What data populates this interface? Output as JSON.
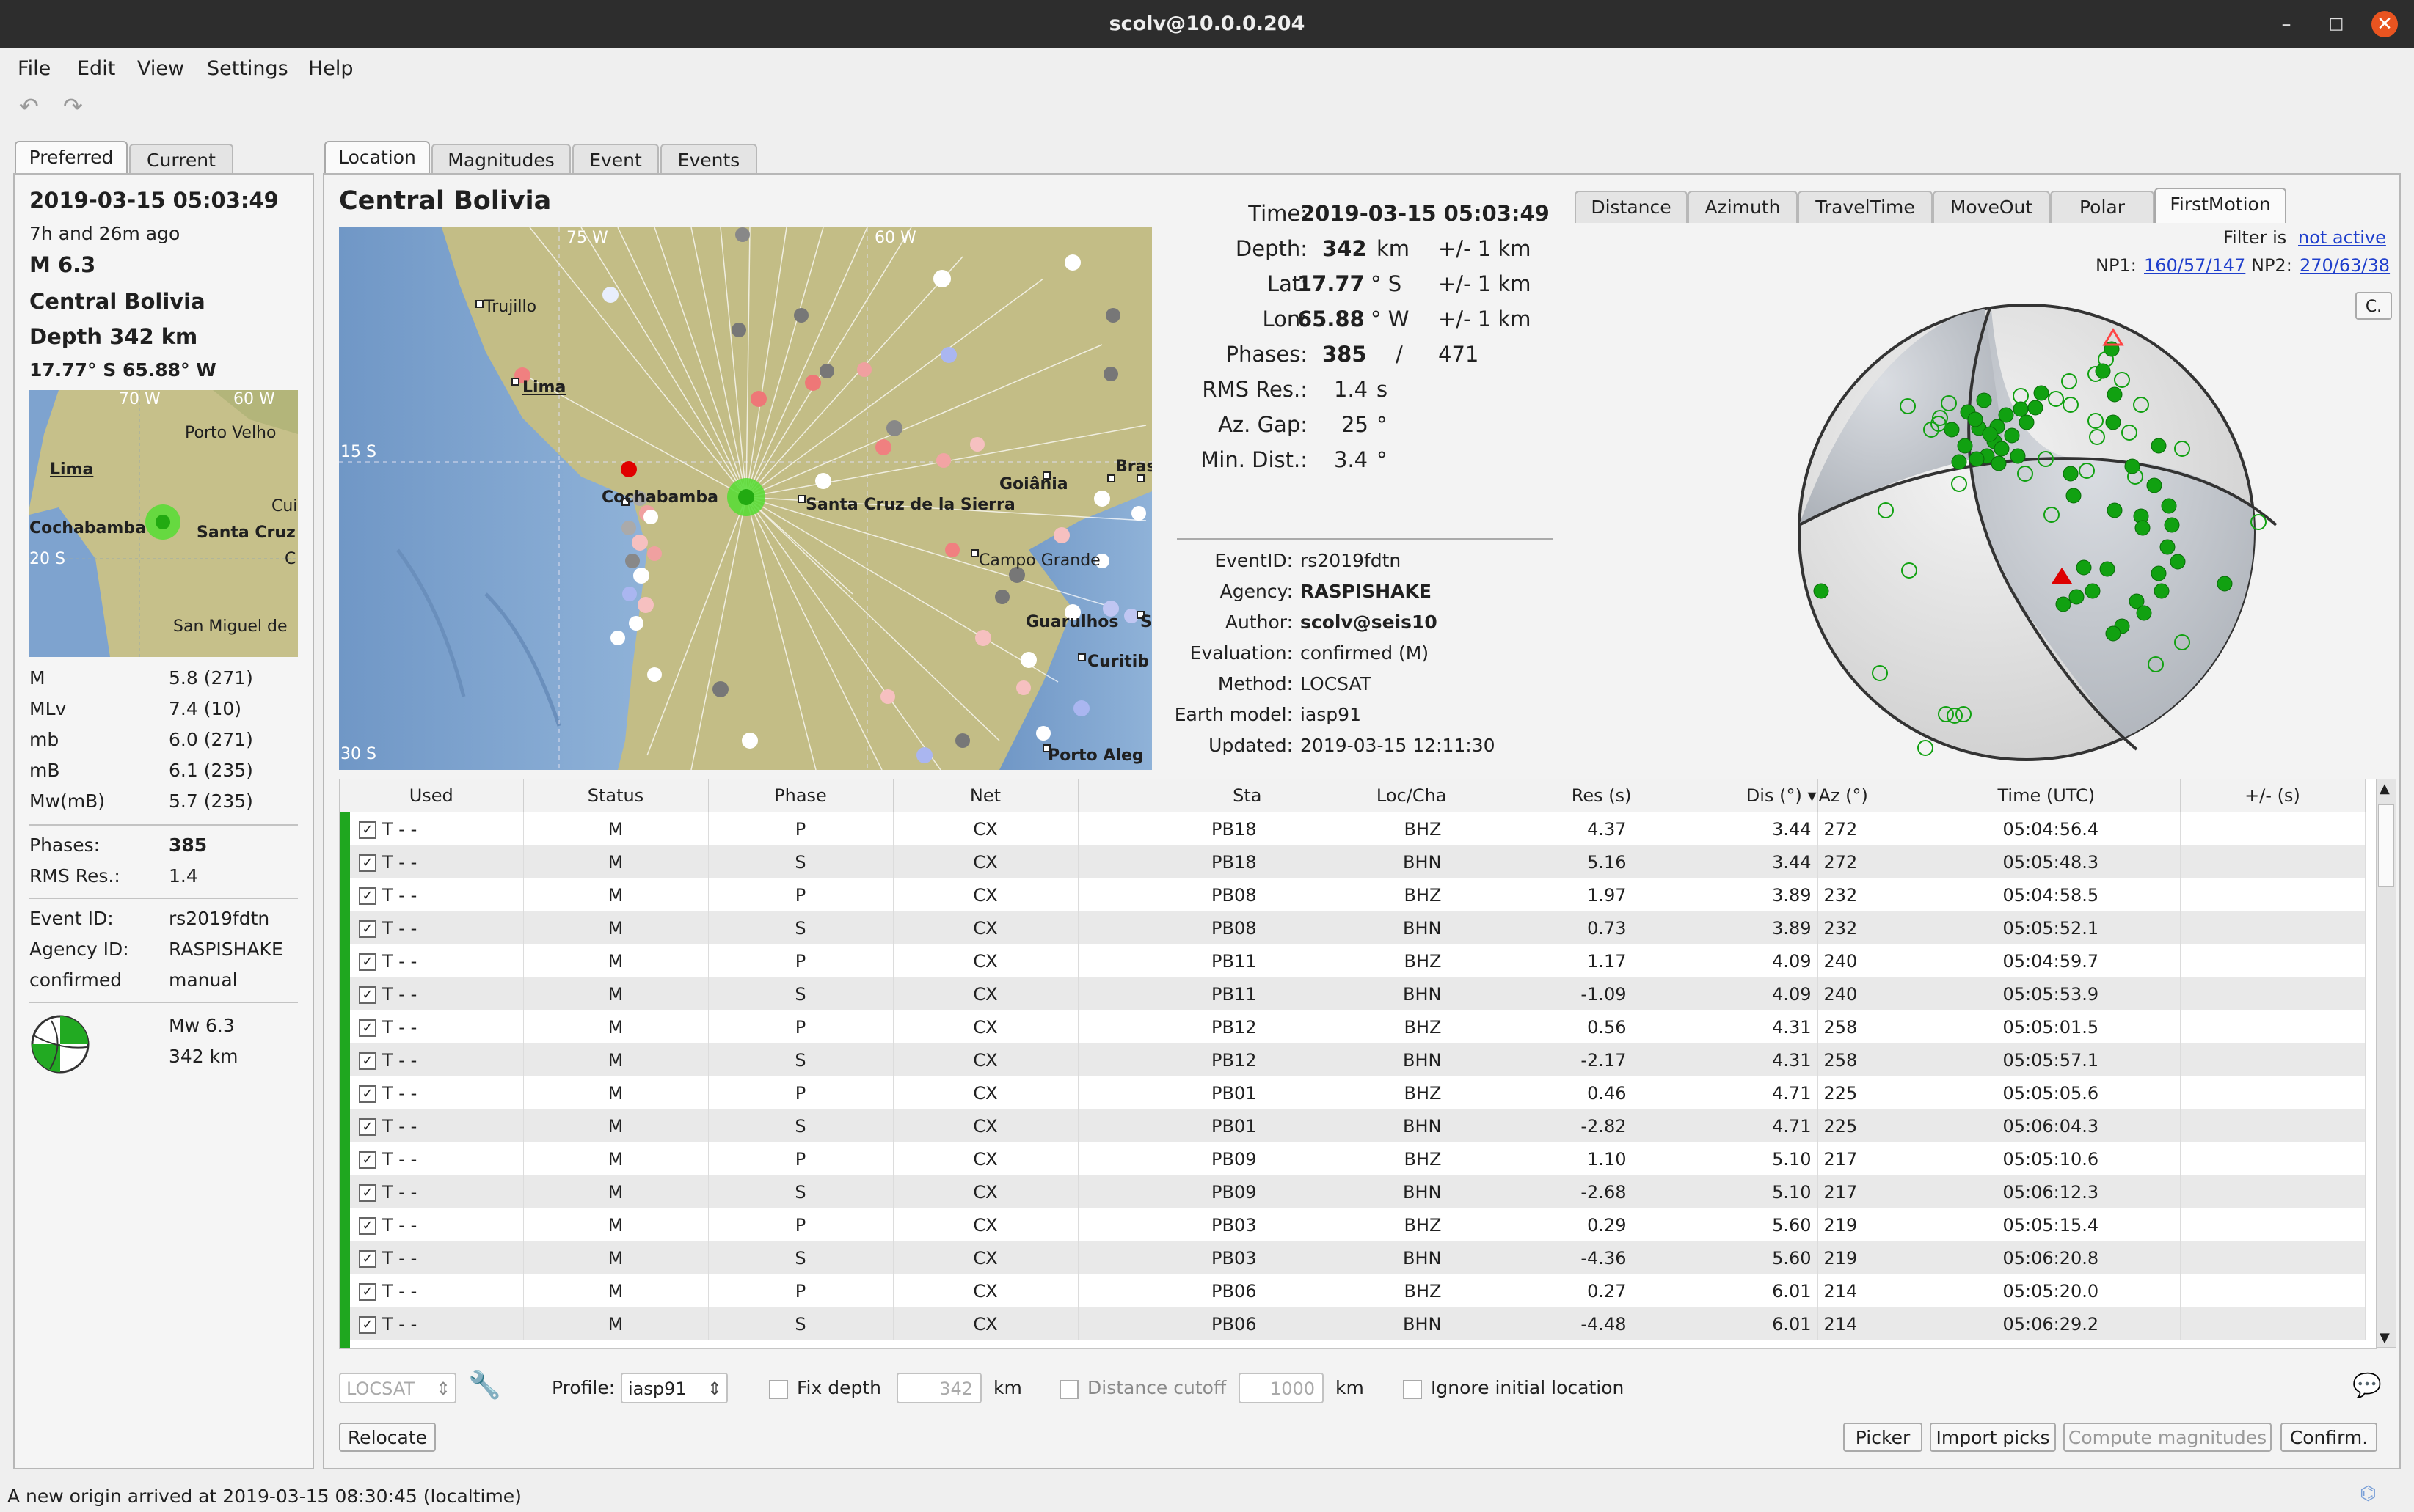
{
  "window": {
    "title": "scolv@10.0.0.204",
    "minimize": "–",
    "maximize": "□",
    "close": "✕"
  },
  "menu": [
    "File",
    "Edit",
    "View",
    "Settings",
    "Help"
  ],
  "toolbar": {
    "undo_icon": "undo-icon",
    "redo_icon": "redo-icon"
  },
  "left_tabs": [
    "Preferred",
    "Current"
  ],
  "summary": {
    "time": "2019-03-15 05:03:49",
    "ago": "7h and 26m ago",
    "magnitude": "M 6.3",
    "region": "Central Bolivia",
    "depth": "Depth 342 km",
    "coords": "17.77° S  65.88° W",
    "map_labels": {
      "lon70": "70 W",
      "lon60": "60 W",
      "lat20": "20 S",
      "porto_velho": "Porto Velho",
      "lima": "Lima",
      "cochabamba": "Cochabamba",
      "santa_cruz": "Santa Cruz",
      "cui": "Cui",
      "c": "C",
      "san_miguel": "San Miguel de"
    },
    "magnitudes": [
      {
        "type": "M",
        "value": "5.8 (271)"
      },
      {
        "type": "MLv",
        "value": "7.4 (10)"
      },
      {
        "type": "mb",
        "value": "6.0 (271)"
      },
      {
        "type": "mB",
        "value": "6.1 (235)"
      },
      {
        "type": "Mw(mB)",
        "value": "5.7 (235)"
      }
    ],
    "phases_label": "Phases:",
    "phases": "385",
    "rms_label": "RMS Res.:",
    "rms": "1.4",
    "event_id_label": "Event ID:",
    "event_id": "rs2019fdtn",
    "agency_label": "Agency ID:",
    "agency": "RASPISHAKE",
    "status_label": "confirmed",
    "status": "manual",
    "mw": "Mw 6.3",
    "fm_depth": "342 km"
  },
  "main_tabs": [
    "Location",
    "Magnitudes",
    "Event",
    "Events"
  ],
  "location": {
    "region": "Central Bolivia",
    "map_labels": {
      "lon75": "75 W",
      "lon60": "60 W",
      "lat15": "15 S",
      "lat30": "30 S",
      "trujillo": "Trujillo",
      "lima": "Lima",
      "cochabamba": "Cochabamba",
      "santa_cruz": "Santa Cruz de la Sierra",
      "goiania": "Goiânia",
      "bras": "Bras",
      "campo_grande": "Campo Grande",
      "guarulhos": "Guarulhos",
      "s": "S",
      "curitiba": "Curitib",
      "porto_alegre": "Porto Aleg"
    },
    "time_label": "Time:",
    "time": "2019-03-15 05:03:49",
    "depth_label": "Depth:",
    "depth": "342",
    "depth_unit": "km",
    "depth_err": "+/- 1  km",
    "lat_label": "Lat:",
    "lat": "17.77",
    "lat_unit": "° S",
    "lat_err": "+/- 1  km",
    "lon_label": "Lon:",
    "lon": "65.88",
    "lon_unit": "° W",
    "lon_err": "+/- 1  km",
    "phases_label": "Phases:",
    "phases": "385",
    "phases_sep": "/",
    "phases_total": "471",
    "rms_label": "RMS Res.:",
    "rms": "1.4",
    "rms_unit": "s",
    "azgap_label": "Az. Gap:",
    "azgap": "25",
    "azgap_unit": "°",
    "mindist_label": "Min. Dist.:",
    "mindist": "3.4",
    "mindist_unit": "°",
    "eventid_label": "EventID:",
    "eventid": "rs2019fdtn",
    "agency_label": "Agency:",
    "agency": "RASPISHAKE",
    "author_label": "Author:",
    "author": "scolv@seis10",
    "evaluation_label": "Evaluation:",
    "evaluation": "confirmed (M)",
    "method_label": "Method:",
    "method": "LOCSAT",
    "earthmodel_label": "Earth model:",
    "earthmodel": "iasp91",
    "updated_label": "Updated:",
    "updated": "2019-03-15 12:11:30"
  },
  "plot_tabs": [
    "Distance",
    "Azimuth",
    "TravelTime",
    "MoveOut",
    "Polar",
    "FirstMotion"
  ],
  "firstmotion": {
    "filter_label": "Filter is",
    "filter_value": "not active",
    "np1_label": "NP1:",
    "np1": "160/57/147",
    "np2_label": "NP2:",
    "np2": "270/63/38",
    "corner_btn": "C."
  },
  "table": {
    "headers": [
      "Used",
      "Status",
      "Phase",
      "Net",
      "Sta",
      "Loc/Cha",
      "Res (s)",
      "Dis (°)",
      "Az (°)",
      "Time (UTC)",
      "+/- (s)"
    ],
    "rows": [
      [
        "T  -  -",
        "M",
        "P",
        "CX",
        "PB18",
        "BHZ",
        "4.37",
        "3.44",
        "272",
        "05:04:56.4",
        ""
      ],
      [
        "T  -  -",
        "M",
        "S",
        "CX",
        "PB18",
        "BHN",
        "5.16",
        "3.44",
        "272",
        "05:05:48.3",
        ""
      ],
      [
        "T  -  -",
        "M",
        "P",
        "CX",
        "PB08",
        "BHZ",
        "1.97",
        "3.89",
        "232",
        "05:04:58.5",
        ""
      ],
      [
        "T  -  -",
        "M",
        "S",
        "CX",
        "PB08",
        "BHN",
        "0.73",
        "3.89",
        "232",
        "05:05:52.1",
        ""
      ],
      [
        "T  -  -",
        "M",
        "P",
        "CX",
        "PB11",
        "BHZ",
        "1.17",
        "4.09",
        "240",
        "05:04:59.7",
        ""
      ],
      [
        "T  -  -",
        "M",
        "S",
        "CX",
        "PB11",
        "BHN",
        "-1.09",
        "4.09",
        "240",
        "05:05:53.9",
        ""
      ],
      [
        "T  -  -",
        "M",
        "P",
        "CX",
        "PB12",
        "BHZ",
        "0.56",
        "4.31",
        "258",
        "05:05:01.5",
        ""
      ],
      [
        "T  -  -",
        "M",
        "S",
        "CX",
        "PB12",
        "BHN",
        "-2.17",
        "4.31",
        "258",
        "05:05:57.1",
        ""
      ],
      [
        "T  -  -",
        "M",
        "P",
        "CX",
        "PB01",
        "BHZ",
        "0.46",
        "4.71",
        "225",
        "05:05:05.6",
        ""
      ],
      [
        "T  -  -",
        "M",
        "S",
        "CX",
        "PB01",
        "BHN",
        "-2.82",
        "4.71",
        "225",
        "05:06:04.3",
        ""
      ],
      [
        "T  -  -",
        "M",
        "P",
        "CX",
        "PB09",
        "BHZ",
        "1.10",
        "5.10",
        "217",
        "05:05:10.6",
        ""
      ],
      [
        "T  -  -",
        "M",
        "S",
        "CX",
        "PB09",
        "BHN",
        "-2.68",
        "5.10",
        "217",
        "05:06:12.3",
        ""
      ],
      [
        "T  -  -",
        "M",
        "P",
        "CX",
        "PB03",
        "BHZ",
        "0.29",
        "5.60",
        "219",
        "05:05:15.4",
        ""
      ],
      [
        "T  -  -",
        "M",
        "S",
        "CX",
        "PB03",
        "BHN",
        "-4.36",
        "5.60",
        "219",
        "05:06:20.8",
        ""
      ],
      [
        "T  -  -",
        "M",
        "P",
        "CX",
        "PB06",
        "BHZ",
        "0.27",
        "6.01",
        "214",
        "05:05:20.0",
        ""
      ],
      [
        "T  -  -",
        "M",
        "S",
        "CX",
        "PB06",
        "BHN",
        "-4.48",
        "6.01",
        "214",
        "05:06:29.2",
        ""
      ]
    ]
  },
  "controls": {
    "locator": "LOCSAT",
    "profile_label": "Profile:",
    "profile": "iasp91",
    "fix_depth_label": "Fix depth",
    "fix_depth_value": "342",
    "km1": "km",
    "distance_cutoff_label": "Distance cutoff",
    "distance_cutoff_value": "1000",
    "km2": "km",
    "ignore_label": "Ignore initial location",
    "relocate": "Relocate",
    "picker": "Picker",
    "import_picks": "Import picks",
    "compute_magnitudes": "Compute magnitudes",
    "confirm": "Confirm."
  },
  "statusbar": "A new origin arrived at 2019-03-15 08:30:45 (localtime)"
}
